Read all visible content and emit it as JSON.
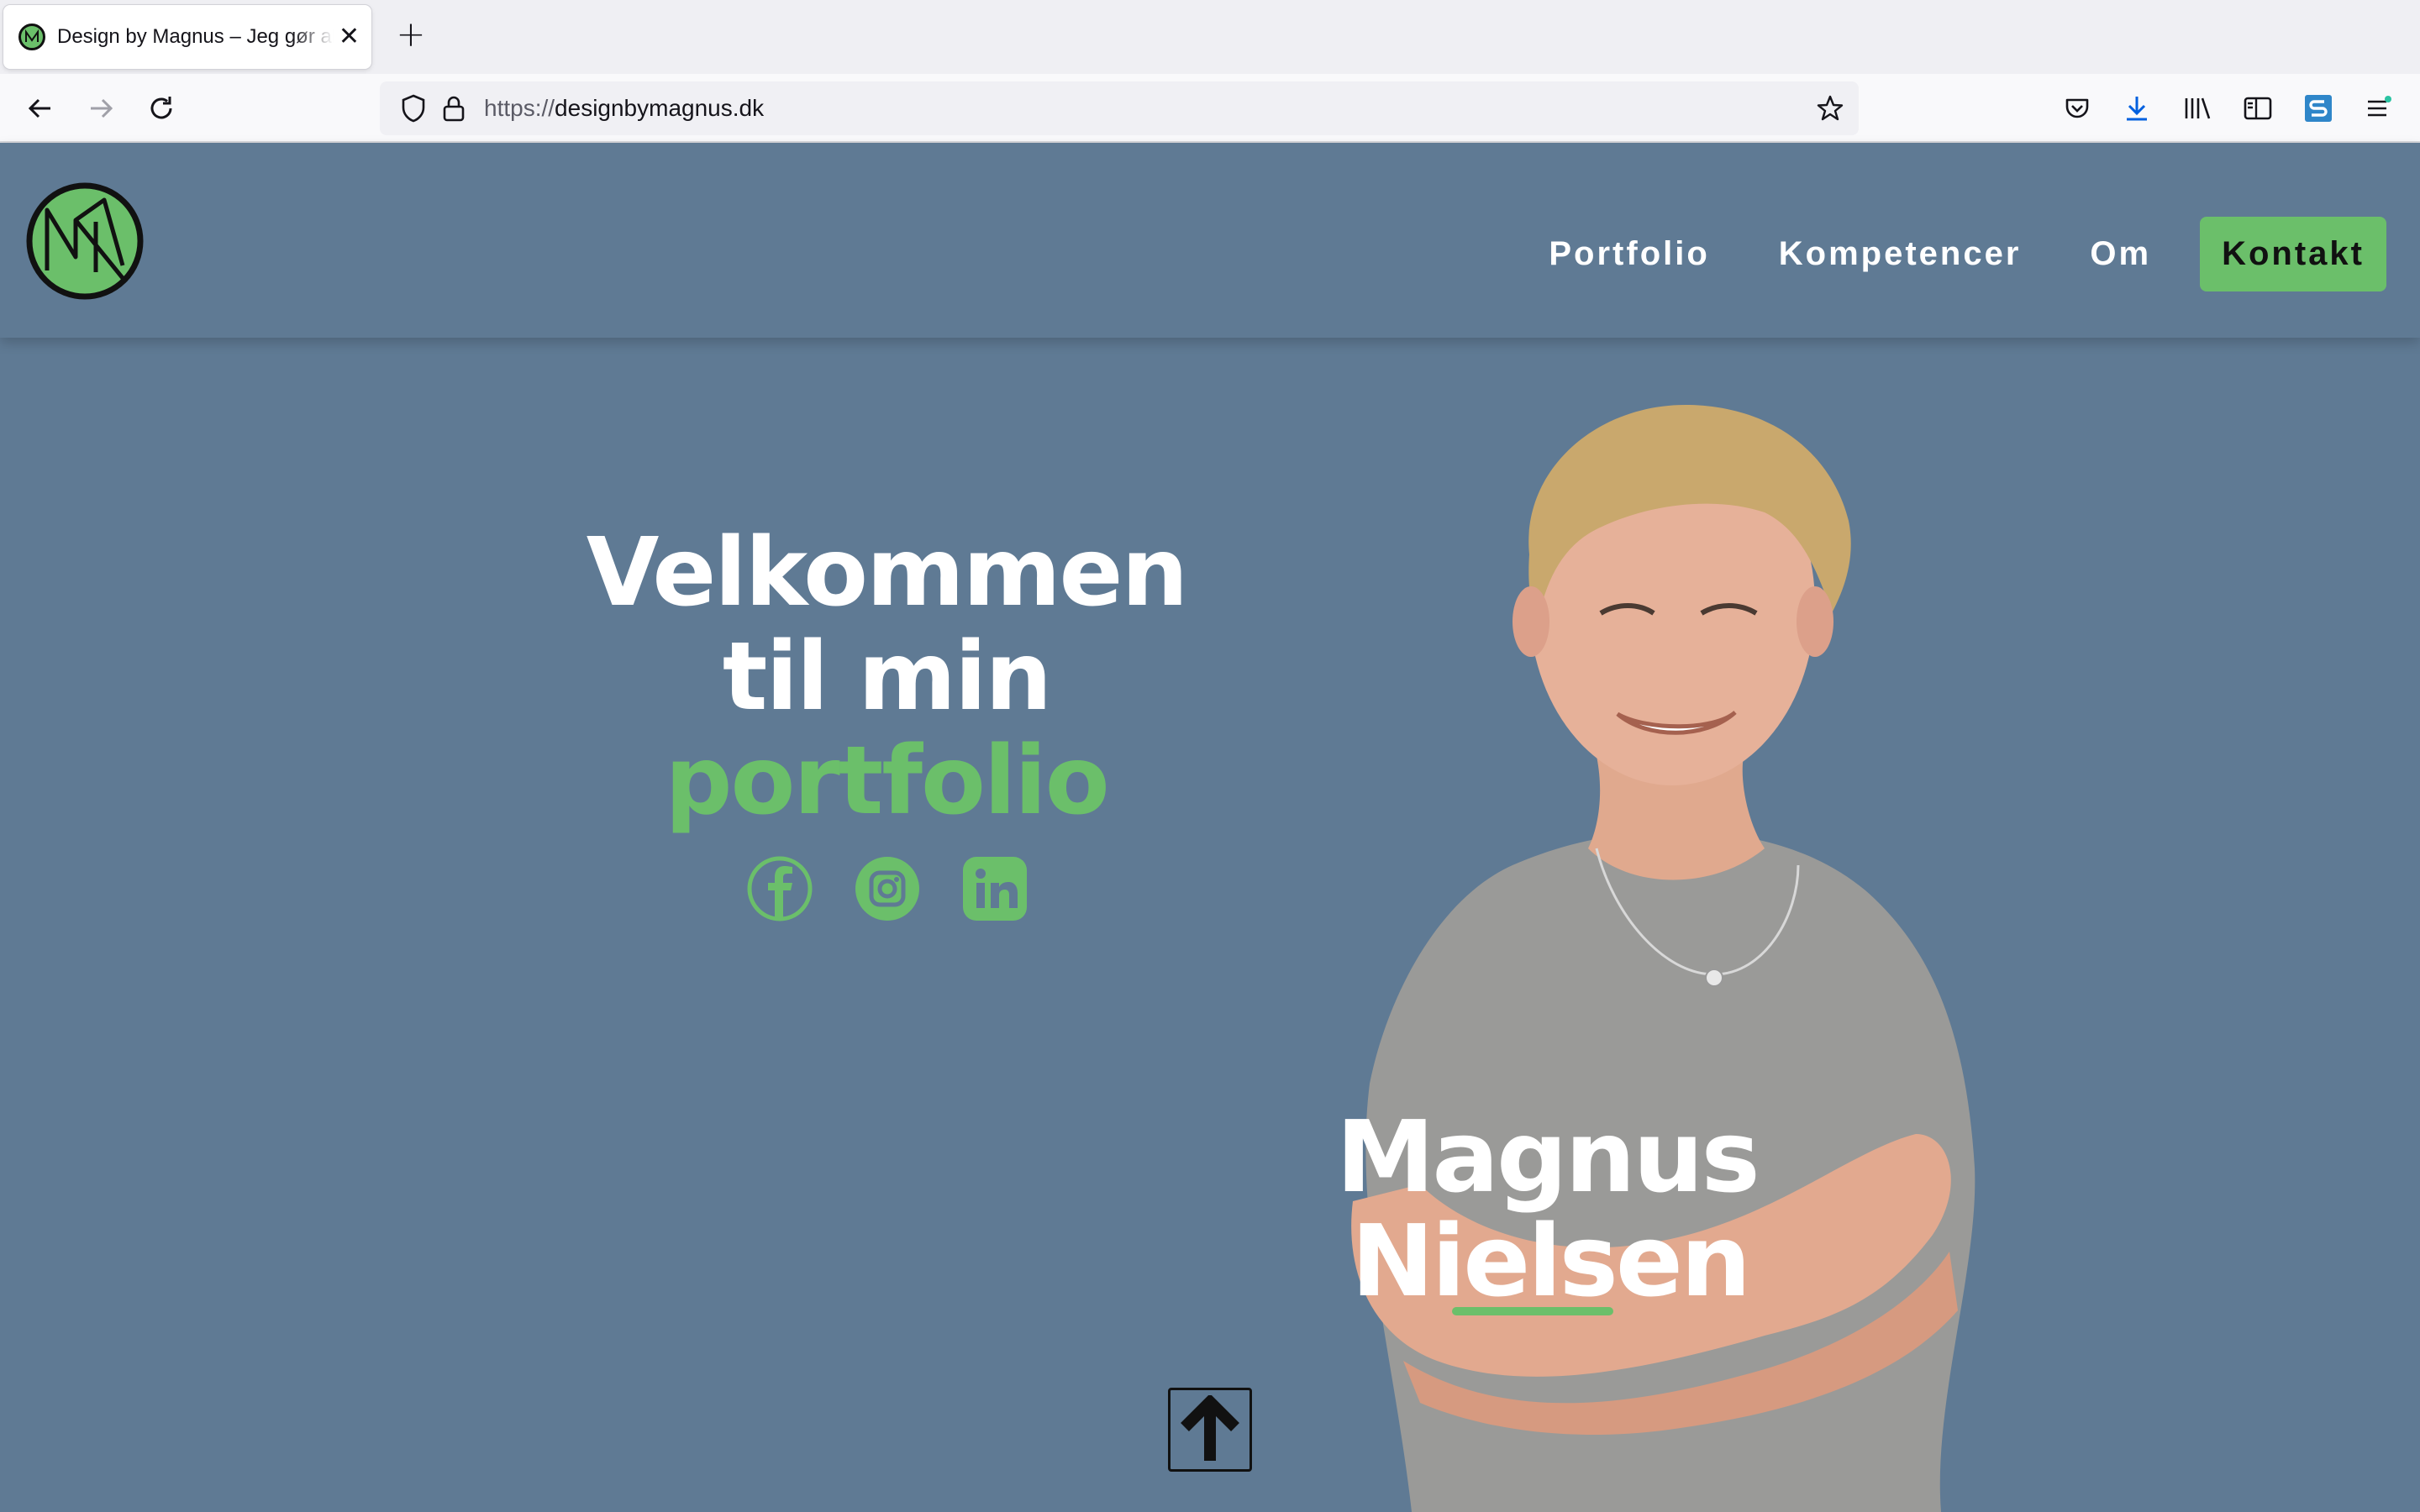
{
  "browser": {
    "tab_title": "Design by Magnus – Jeg gør alt",
    "new_tab_symbol": "+",
    "close_symbol": "✕",
    "url_scheme": "https://",
    "url_host": "designbymagnus.dk"
  },
  "site": {
    "nav": {
      "portfolio": "Portfolio",
      "kompetencer": "Kompetencer",
      "om": "Om",
      "kontakt": "Kontakt"
    },
    "hero": {
      "line1": "Velkommen",
      "line2": "til min",
      "accent": "portfolio"
    },
    "socials": [
      "facebook-icon",
      "instagram-icon",
      "linkedin-icon"
    ],
    "name_first": "Magnus",
    "name_last": "Nielsen"
  },
  "colors": {
    "page_bg": "#5f7a94",
    "accent_green": "#6bbf6a",
    "text_white": "#ffffff"
  }
}
